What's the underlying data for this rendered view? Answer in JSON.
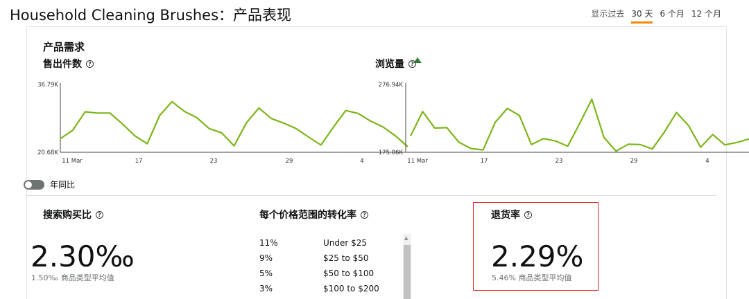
{
  "title": "Household Cleaning Brushes：产品表现",
  "range": {
    "label": "显示过去",
    "options": [
      "30 天",
      "6 个月",
      "12 个月"
    ],
    "active": 0
  },
  "section_title": "产品需求",
  "charts": [
    {
      "title": "售出件数",
      "ymax_label": "36.79K",
      "ymin_label": "20.68K",
      "x_ticks": [
        "11 Mar",
        "17",
        "23",
        "29",
        "4"
      ],
      "color": "#7cb518",
      "values": [
        23.9,
        25.9,
        30.3,
        30.0,
        30.0,
        27.4,
        24.6,
        22.7,
        29.4,
        32.7,
        30.4,
        28.9,
        26.3,
        25.3,
        22.2,
        27.7,
        31.2,
        28.7,
        27.6,
        26.3,
        24.3,
        22.4,
        26.6,
        30.6,
        29.9,
        28.1,
        26.7,
        24.6,
        22.0
      ]
    },
    {
      "title": "浏览量",
      "ymax_label": "276.94K",
      "ymin_label": "175.06K",
      "x_ticks": [
        "11 Mar",
        "17",
        "23",
        "29",
        "4"
      ],
      "color": "#7cb518",
      "values": [
        199.5,
        236.2,
        211.4,
        212.1,
        190.1,
        180.7,
        178.6,
        219.9,
        241.0,
        230.4,
        186.6,
        195.6,
        192.0,
        184.1,
        218.6,
        254.7,
        197.3,
        176.7,
        187.1,
        186.6,
        180.0,
        205.4,
        234.8,
        215.1,
        182.6,
        201.8,
        186.2,
        189.8,
        195.0
      ]
    }
  ],
  "yoy_toggle_label": "年同比",
  "search_purchase": {
    "title": "搜索购买比",
    "value": "2.30‰",
    "sub": "1.50‰ 商品类型平均值"
  },
  "conversion": {
    "title": "每个价格范围的转化率",
    "rows": [
      {
        "pct": "11%",
        "range": "Under $25"
      },
      {
        "pct": "9%",
        "range": "$25 to $50"
      },
      {
        "pct": "5%",
        "range": "$50 to $100"
      },
      {
        "pct": "3%",
        "range": "$100 to $200"
      }
    ]
  },
  "return_rate": {
    "title": "退货率",
    "value": "2.29%",
    "sub": "5.46% 商品类型平均值"
  },
  "help_glyph": "?"
}
